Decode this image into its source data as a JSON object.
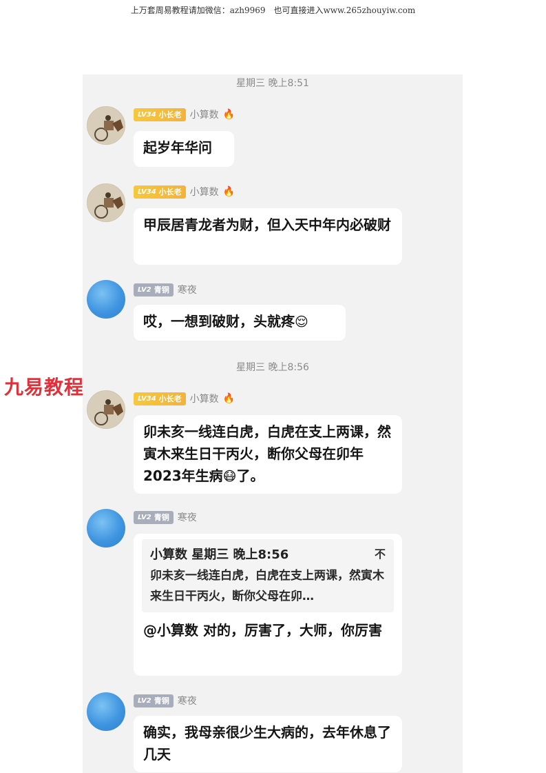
{
  "watermark_top": "上万套周易教程请加微信：azh9969　也可直接进入www.265zhouyiw.com",
  "side_logo": "九易教程",
  "times": [
    "星期三 晚上8:51",
    "星期三 晚上8:56"
  ],
  "badges": {
    "gold": {
      "lv": "LV34",
      "title": "小长老"
    },
    "gray": {
      "lv": "LV2",
      "title": "青铜"
    }
  },
  "users": {
    "a": "小算数",
    "b": "寒夜"
  },
  "fire_icon": "🔥",
  "messages": [
    {
      "text": "起岁年华问"
    },
    {
      "text": "甲辰居青龙者为财，但入天中年内必破财"
    },
    {
      "text": "哎，一想到破财，头就疼",
      "emoji": "😌"
    },
    {
      "text": "卯未亥一线连白虎，白虎在支上两课，然寅木来生日干丙火，断你父母在卯年2023年生病",
      "emoji": "😷",
      "tail": "了。"
    },
    {
      "quote_head": "小算数 星期三 晚上8:56",
      "quote_close": "不",
      "quote_text": "卯未亥一线连白虎，白虎在支上两课，然寅木来生日干丙火，断你父母在卯…",
      "text": "@小算数 对的，厉害了，大师，你厉害"
    },
    {
      "text": "确实，我母亲很少生大病的，去年休息了几天"
    }
  ]
}
